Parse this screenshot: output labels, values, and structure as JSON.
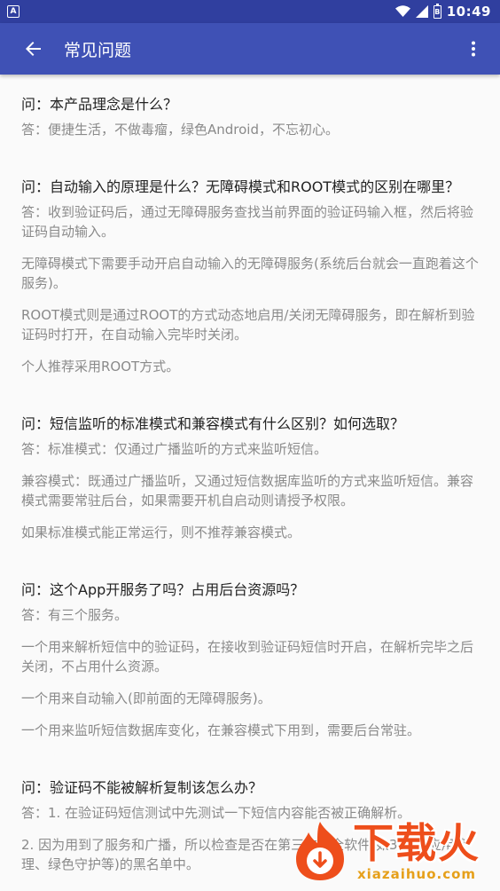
{
  "status_bar": {
    "notification_icon": "A",
    "battery_badge": "B",
    "time": "10:49"
  },
  "toolbar": {
    "title": "常见问题"
  },
  "faqs": [
    {
      "question": "问：本产品理念是什么？",
      "answers": [
        "答：便捷生活，不做毒瘤，绿色Android，不忘初心。"
      ]
    },
    {
      "question": "问：自动输入的原理是什么？无障碍模式和ROOT模式的区别在哪里？",
      "answers": [
        "答：收到验证码后，通过无障碍服务查找当前界面的验证码输入框，然后将验证码自动输入。",
        "无障碍模式下需要手动开启自动输入的无障碍服务(系统后台就会一直跑着这个服务)。",
        "ROOT模式则是通过ROOT的方式动态地启用/关闭无障碍服务，即在解析到验证码时打开，在自动输入完毕时关闭。",
        "个人推荐采用ROOT方式。"
      ]
    },
    {
      "question": "问：短信监听的标准模式和兼容模式有什么区别？如何选取？",
      "answers": [
        "答：标准模式：仅通过广播监听的方式来监听短信。",
        "兼容模式：既通过广播监听，又通过短信数据库监听的方式来监听短信。兼容模式需要常驻后台，如果需要开机自启动则请授予权限。",
        "如果标准模式能正常运行，则不推荐兼容模式。"
      ]
    },
    {
      "question": "问：这个App开服务了吗？占用后台资源吗？",
      "answers": [
        "答：有三个服务。",
        "一个用来解析短信中的验证码，在接收到验证码短信时开启，在解析完毕之后关闭，不占用什么资源。",
        "一个用来自动输入(即前面的无障碍服务)。",
        "一个用来监听短信数据库变化，在兼容模式下用到，需要后台常驻。"
      ]
    },
    {
      "question": "问：验证码不能被解析复制该怎么办？",
      "answers": [
        "答：1. 在验证码短信测试中先测试一下短信内容能否被正确解析。",
        "2. 因为用到了服务和广播，所以检查是否在第三方安全软件(如360、应用管理、绿色守护等)的黑名单中。"
      ]
    }
  ],
  "watermark": {
    "main": "下载火",
    "sub": "xiazaihuo.com"
  },
  "colors": {
    "status_bar": "#303f9f",
    "toolbar": "#3f51b5",
    "question_text": "#222222",
    "answer_text": "#8a8a8a"
  }
}
